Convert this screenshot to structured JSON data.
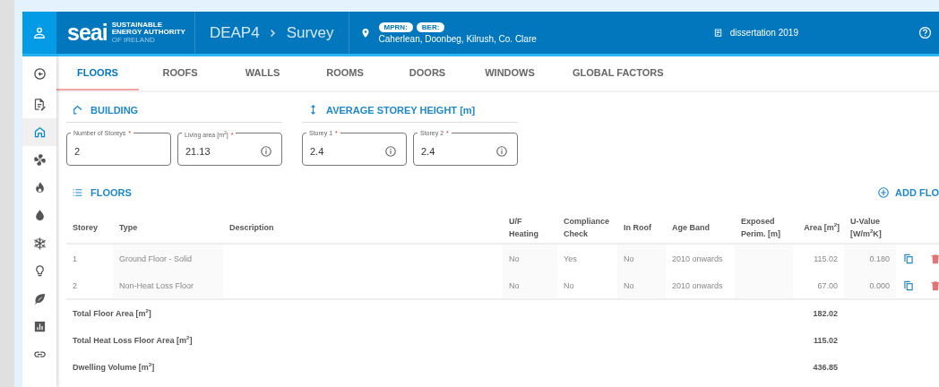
{
  "header": {
    "logo": "seai",
    "logo_tagline": [
      "SUSTAINABLE",
      "ENERGY AUTHORITY",
      "OF IRELAND"
    ],
    "breadcrumb": [
      "DEAP4",
      "Survey"
    ],
    "badges": [
      "MPRN:",
      "BER:"
    ],
    "address": "Caherlean, Doonbeg, Kilrush, Co. Clare",
    "assessment": "dissertation 2019"
  },
  "sidebar": {
    "items": [
      {
        "kind": "document",
        "selected": false
      },
      {
        "kind": "home",
        "selected": true
      },
      {
        "kind": "fan",
        "selected": false
      },
      {
        "kind": "flame",
        "selected": false
      },
      {
        "kind": "drop",
        "selected": false
      },
      {
        "kind": "snowflake",
        "selected": false
      },
      {
        "kind": "bulb",
        "selected": false
      },
      {
        "kind": "leaf",
        "selected": false
      },
      {
        "kind": "chart",
        "selected": false
      },
      {
        "kind": "link",
        "selected": false
      }
    ]
  },
  "tabs": [
    {
      "label": "FLOORS",
      "selected": true
    },
    {
      "label": "ROOFS",
      "selected": false
    },
    {
      "label": "WALLS",
      "selected": false
    },
    {
      "label": "ROOMS",
      "selected": false
    },
    {
      "label": "DOORS",
      "selected": false
    },
    {
      "label": "WINDOWS",
      "selected": false
    },
    {
      "label": "GLOBAL FACTORS",
      "selected": false
    }
  ],
  "sections": [
    {
      "kind": "building",
      "title": "BUILDING",
      "fields": [
        {
          "label": "Number of Storeys",
          "marker": "*",
          "value": "2",
          "info": false
        },
        {
          "label": "Living area [m$^{2}$]",
          "marker": "*",
          "value": "21.13",
          "info": true
        }
      ]
    },
    {
      "kind": "height",
      "title": "AVERAGE STOREY HEIGHT [m]",
      "fields": [
        {
          "label": "Storey 1",
          "marker": "*",
          "value": "2.4",
          "info": true
        },
        {
          "label": "Storey 2",
          "marker": "*",
          "value": "2.4",
          "info": true
        }
      ]
    }
  ],
  "floors": {
    "title": "FLOORS",
    "add_button": "ADD FLO",
    "columns": [
      "Storey",
      "Type",
      "Description",
      "U/F Heating",
      "Compliance Check",
      "In Roof",
      "Age Band",
      "Exposed Perim. [m]",
      "Area [m$^{2}$]",
      "U-Value [W/m$^{2}$K]"
    ],
    "rows": [
      {
        "cells": [
          "1",
          "Ground Floor - Solid",
          "",
          "No",
          "Yes",
          "No",
          "2010 onwards",
          "",
          "115.02",
          "0.180"
        ]
      },
      {
        "cells": [
          "2",
          "Non-Heat Loss Floor",
          "",
          "No",
          "No",
          "No",
          "2010 onwards",
          "",
          "67.00",
          "0.000"
        ]
      }
    ],
    "totals": [
      {
        "label": "Total Floor Area [m$^{2}$]",
        "value": "182.02"
      },
      {
        "label": "Total Heat Loss Floor Area [m$^{2}$]",
        "value": "115.02"
      },
      {
        "label": "Dwelling Volume [m$^{3}$]",
        "value": "436.85"
      }
    ]
  }
}
